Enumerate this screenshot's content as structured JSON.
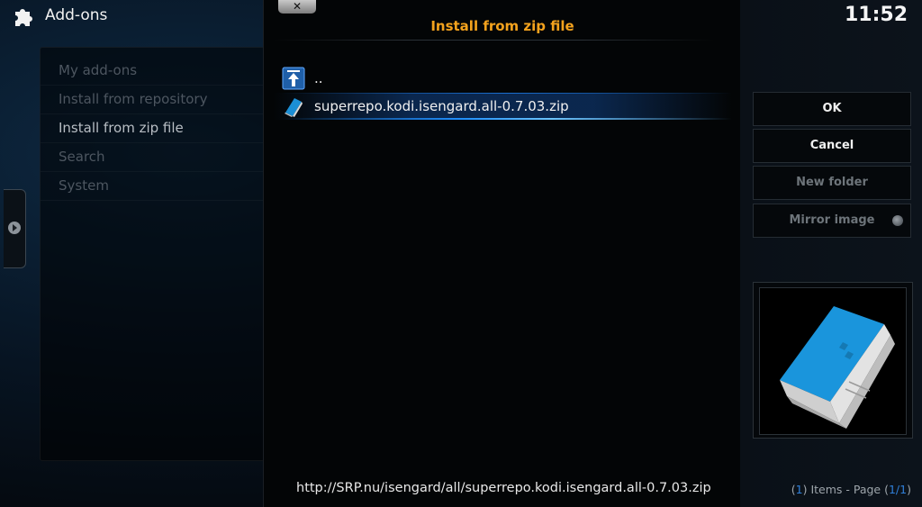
{
  "header": {
    "title": "Add-ons",
    "icon": "puzzle-icon"
  },
  "menu": {
    "items": [
      {
        "label": "My add-ons",
        "active": false
      },
      {
        "label": "Install from repository",
        "active": false
      },
      {
        "label": "Install from zip file",
        "active": true
      },
      {
        "label": "Search",
        "active": false
      },
      {
        "label": "System",
        "active": false
      }
    ]
  },
  "dialog": {
    "close_label": "✕",
    "title": "Install from zip file",
    "files": [
      {
        "label": "..",
        "icon": "parent-folder-icon"
      },
      {
        "label": "superrepo.kodi.isengard.all-0.7.03.zip",
        "icon": "zip-file-icon"
      }
    ],
    "path": "http://SRP.nu/isengard/all/superrepo.kodi.isengard.all-0.7.03.zip"
  },
  "right": {
    "clock": "11:52",
    "ok_label": "OK",
    "cancel_label": "Cancel",
    "new_folder_label": "New folder",
    "mirror_label": "Mirror image",
    "items_count": "1",
    "items_text": "Items - Page",
    "page_current": "1/1"
  },
  "colors": {
    "accent_title": "#f3a21d",
    "selection_blue": "#1f8fff",
    "page_number_blue": "#2f7fd8"
  }
}
